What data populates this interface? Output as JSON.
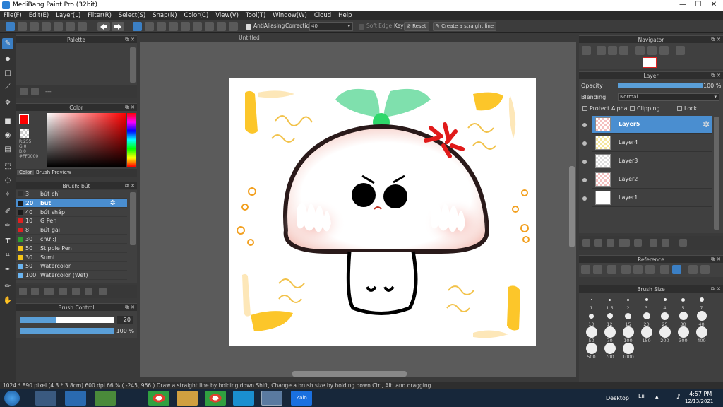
{
  "title_bar": {
    "title": "MediBang Paint Pro (32bit)",
    "minimize": "—",
    "maximize": "☐",
    "close": "✕"
  },
  "menu": [
    "File(F)",
    "Edit(E)",
    "Layer(L)",
    "Filter(R)",
    "Select(S)",
    "Snap(N)",
    "Color(C)",
    "View(V)",
    "Tool(T)",
    "Window(W)",
    "Cloud",
    "Help"
  ],
  "toolbar": {
    "antialiasing_label": "AntiAliasing",
    "correction_label": "Correction",
    "correction_value": "40",
    "soft_edge_label": "Soft Edge",
    "key_label": "Key",
    "reset_label": "Reset",
    "straight_line_label": "Create a straight line"
  },
  "palette_panel": {
    "title": "Palette",
    "dash": "---"
  },
  "color_panel": {
    "title": "Color",
    "r": "R:255",
    "g": "G:0",
    "b": "B:0",
    "hex": "#FF0000",
    "tabs": [
      "Color",
      "Brush Preview"
    ],
    "primary_color": "#ff0000"
  },
  "brush_panel": {
    "title": "Brush: bút",
    "items": [
      {
        "size": "3",
        "name": "bút chì",
        "color": "#333333"
      },
      {
        "size": "20",
        "name": "bút",
        "color": "#1a1a1a"
      },
      {
        "size": "40",
        "name": "bút sháp",
        "color": "#1a1a1a"
      },
      {
        "size": "10",
        "name": "G Pen",
        "color": "#e02020"
      },
      {
        "size": "8",
        "name": "bút gai",
        "color": "#e02020"
      },
      {
        "size": "30",
        "name": "chữ :)",
        "color": "#2ea02e"
      },
      {
        "size": "50",
        "name": "Stipple Pen",
        "color": "#f5c518"
      },
      {
        "size": "30",
        "name": "Sumi",
        "color": "#f5c518"
      },
      {
        "size": "50",
        "name": "Watercolor",
        "color": "#6ab4f0"
      },
      {
        "size": "100",
        "name": "Watercolor (Wet)",
        "color": "#6ab4f0"
      }
    ]
  },
  "brush_control": {
    "title": "Brush Control",
    "size_value": "20",
    "opacity_value": "100 %",
    "size_fraction": 0.38,
    "opacity_fraction": 1.0
  },
  "document": {
    "tab_title": "Untitled"
  },
  "navigator": {
    "title": "Navigator"
  },
  "layer_panel": {
    "title": "Layer",
    "opacity_label": "Opacity",
    "opacity_value": "100 %",
    "blending_label": "Blending",
    "blending_value": "Normal",
    "protect_alpha": "Protect Alpha",
    "clipping": "Clipping",
    "lock": "Lock",
    "layers": [
      "Layer5",
      "Layer4",
      "Layer3",
      "Layer2",
      "Layer1"
    ]
  },
  "reference": {
    "title": "Reference"
  },
  "brush_size": {
    "title": "Brush Size",
    "sizes": [
      "1",
      "1.5",
      "2",
      "3",
      "4",
      "5",
      "7",
      "10",
      "12",
      "15",
      "20",
      "25",
      "30",
      "40",
      "50",
      "70",
      "100",
      "150",
      "200",
      "300",
      "400",
      "500",
      "700",
      "1000"
    ]
  },
  "status": "1024 * 890 pixel   (4.3 * 3.8cm)   600 dpi   66 %   ( -245, 966 )   Draw a straight line by holding down Shift, Change a brush size by holding down Ctrl, Alt, and dragging",
  "taskbar": {
    "desktop_label": "Desktop",
    "lang": "Lii",
    "time": "4:57 PM",
    "date": "12/13/2021",
    "zalo": "Zalo"
  }
}
